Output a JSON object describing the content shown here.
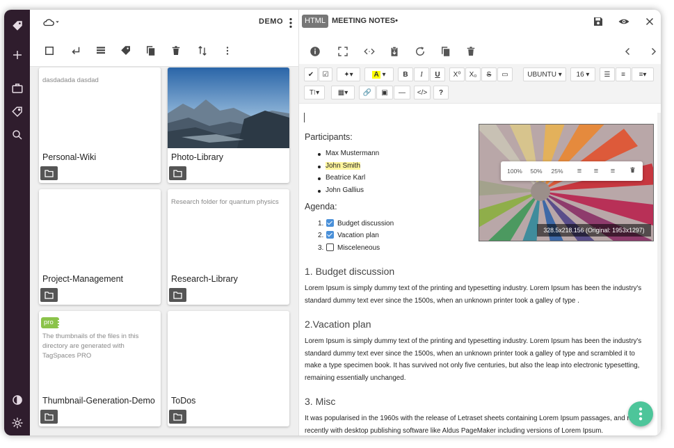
{
  "location": {
    "name": "DEMO"
  },
  "folders": [
    {
      "title": "Personal-Wiki",
      "desc": "dasdadada dasdad"
    },
    {
      "title": "Photo-Library",
      "desc": ""
    },
    {
      "title": "Project-Management",
      "desc": ""
    },
    {
      "title": "Research-Library",
      "desc": "Research folder for quantum physics"
    },
    {
      "title": "Thumbnail-Generation-Demo",
      "desc": "The thumbnails of the files in this directory are generated with TagSpaces PRO",
      "badge": "pro"
    },
    {
      "title": "ToDos",
      "desc": ""
    }
  ],
  "editor": {
    "type_badge": "HTML",
    "file_title": "MEETING NOTES",
    "unsaved_marker": "•",
    "font_name": "UBUNTU",
    "font_size": "16",
    "heading_btn": "T⁝",
    "participants_label": "Participants:",
    "participants": [
      "Max Mustermann",
      "John Smith",
      "Beatrice Karl",
      "John Gallius"
    ],
    "agenda_label": "Agenda:",
    "agenda": [
      {
        "num": "1.",
        "text": "Budget discussion",
        "checked": true
      },
      {
        "num": "2.",
        "text": "Vacation plan",
        "checked": true
      },
      {
        "num": "3.",
        "text": "Misceleneous",
        "checked": false
      }
    ],
    "sections": [
      {
        "heading": "1. Budget discussion",
        "body": "Lorem Ipsum is simply dummy text of the printing and typesetting industry. Lorem Ipsum has been the industry's standard dummy text ever since the 1500s, when an unknown printer took a galley of type ."
      },
      {
        "heading": "2.Vacation plan",
        "body": "Lorem Ipsum is simply dummy text of the printing and typesetting industry.  Lorem Ipsum has been the industry's standard dummy text ever since the 1500s, when an unknown printer took a galley of type and scrambled it to make a type specimen book. It has survived not only five centuries, but also the leap into electronic typesetting, remaining essentially unchanged."
      },
      {
        "heading": "3. Misc",
        "body": "It was popularised in the 1960s with the release of Letraset sheets containing Lorem Ipsum passages, and more recently with desktop publishing software like Aldus PageMaker including versions of Lorem Ipsum."
      }
    ],
    "image_popup": {
      "p100": "100%",
      "p50": "50%",
      "p25": "25%"
    },
    "image_dims": "328.5x218.156 (Original: 1953x1297)"
  },
  "colors": {
    "rail": "#2f1d2d",
    "fab": "#4dc59a",
    "pro": "#8bc34a",
    "check": "#4a90d9"
  }
}
